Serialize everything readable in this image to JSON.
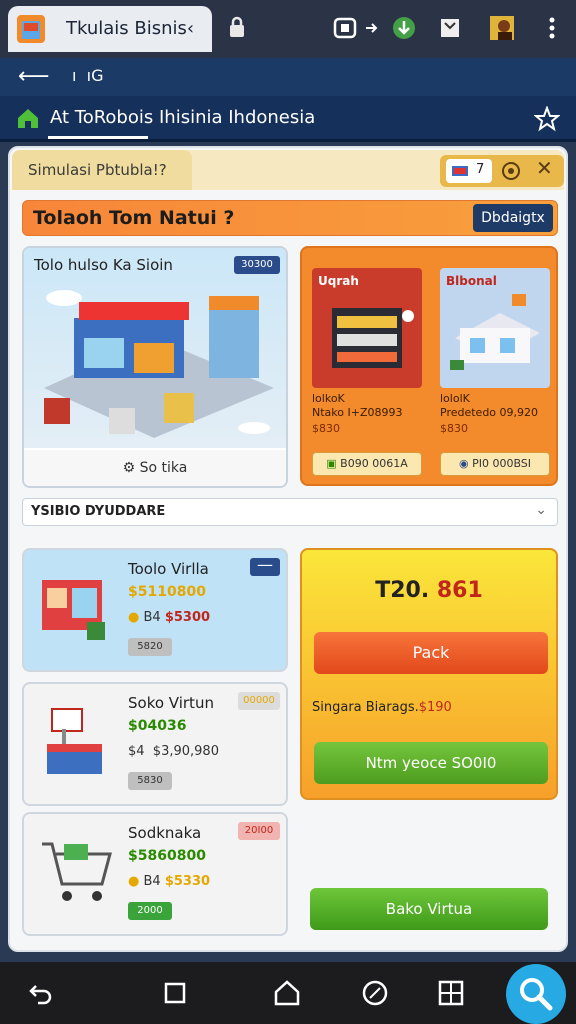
{
  "browser": {
    "tab_title": "Tkulais Bisnis‹",
    "address": "ı  ıG"
  },
  "page": {
    "title": "At ToRobois Ihisinia Ihdonesia"
  },
  "app": {
    "sim_label": "Simulasi Pbtubla!?",
    "ctrl_num": "7",
    "banner_title": "Tolaoh Tom Natui ?",
    "banner_button": "Dbdaigtx",
    "featured": {
      "title": "Tolo hulso Ka Sioin",
      "badge": "30300",
      "footer": "So tika"
    },
    "promo": [
      {
        "label": "Uqrah",
        "text": "lolkoK\nNtako I+Z08993",
        "price": "$830",
        "button": "B090 0061A"
      },
      {
        "label": "Blbonal",
        "text": "lololK\nPredetedo 09,920",
        "price": "$830",
        "button": "PI0 000BSI"
      }
    ],
    "dropdown_label": "YSIBIO DYUDDARE",
    "products": [
      {
        "name": "Toolo Virlla",
        "price": "$5110800",
        "line_a": "B4",
        "line_b": "$5300",
        "tag": "5820",
        "badge": "—"
      },
      {
        "name": "Soko Virtun",
        "price": "$04036",
        "line_a": "$4  $3,90,980",
        "line_b": "",
        "tag": "5830",
        "badge": "00000"
      },
      {
        "name": "Sodknaka",
        "price": "$5860800",
        "line_a": "B4",
        "line_b": "$5330",
        "tag": "2000",
        "badge": "20I00"
      }
    ],
    "summary": {
      "value_a": "T20.",
      "value_b": "861",
      "button1": "Pack",
      "info_a": "Singara Biarags.",
      "info_b": "$190",
      "button2": "Ntm yeoce SO0I0"
    },
    "bottom_button": "Bako Virtua"
  },
  "colors": {
    "accent_orange": "#f38a2b",
    "accent_green": "#4e9d20",
    "nav_blue": "#1b3b66",
    "fab_blue": "#27a9e3"
  }
}
